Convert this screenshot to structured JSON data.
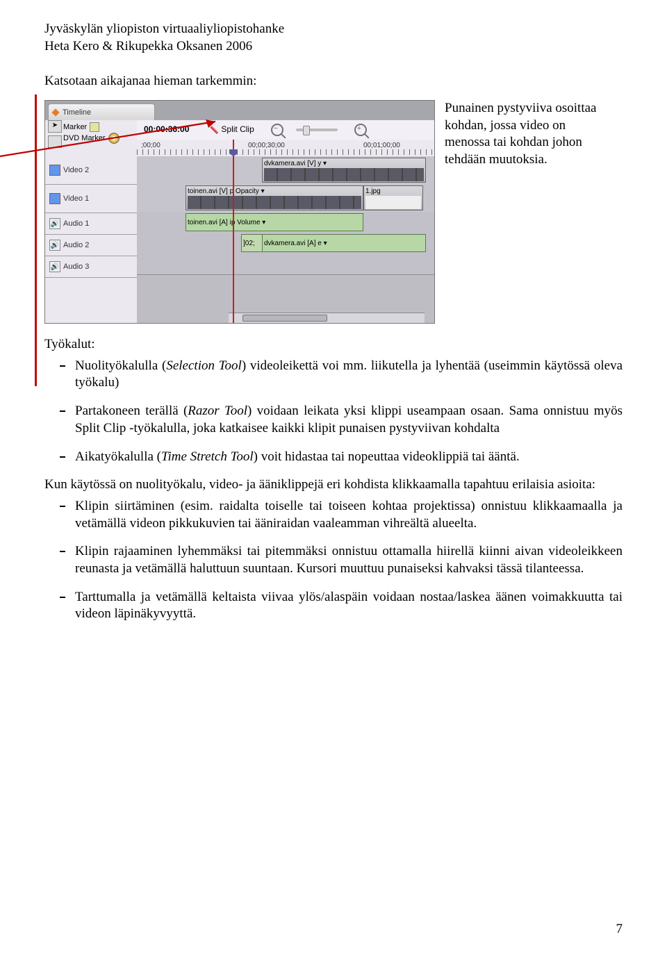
{
  "header": {
    "line1": "Jyväskylän yliopiston virtuaaliyliopistohanke",
    "line2": "Heta Kero & Rikupekka Oksanen 2006"
  },
  "intro": "Katsotaan aikajanaa hieman tarkemmin:",
  "callout": "Punainen pystyviiva osoittaa kohdan, jossa video on menossa tai kohdan johon tehdään muutoksia.",
  "timeline": {
    "tab_label": "Timeline",
    "timecode": "00:00:36:00",
    "split_clip": "Split Clip",
    "left_labels": {
      "marker": "Marker",
      "dvd_marker": "DVD Marker",
      "video2": "Video 2",
      "video1": "Video 1",
      "audio1": "Audio 1",
      "audio2": "Audio 2",
      "audio3": "Audio 3"
    },
    "ruler": {
      "t0": ";00;00",
      "t1": "00;00;30;00",
      "t2": "00;01;00;00"
    },
    "clips": {
      "v2_main": "dvkamera.avi [V] y ▾",
      "v1_main": "toinen.avi [V] p Opacity ▾",
      "v1_img": "1.jpg",
      "a1_main": "toinen.avi [A] ip Volume ▾",
      "a2_left": "]02;",
      "a2_main": "dvkamera.avi [A] e ▾"
    }
  },
  "tools_heading": "Työkalut:",
  "tools_list": [
    {
      "pre": "Nuolityökalulla (",
      "em": "Selection Tool",
      "post": ") videoleikettä voi mm. liikutella ja lyhentää (useimmin käytössä oleva työkalu)"
    },
    {
      "pre": "Partakoneen terällä (",
      "em": "Razor Tool",
      "post": ") voidaan leikata yksi klippi useampaan osaan. Sama onnistuu myös Split Clip -työkalulla, joka katkaisee kaikki klipit punaisen pystyviivan kohdalta"
    },
    {
      "pre": "Aikatyökalulla (",
      "em": "Time Stretch Tool",
      "post": ") voit hidastaa tai nopeuttaa videoklippiä tai ääntä."
    }
  ],
  "para2": "Kun käytössä on nuolityökalu, video- ja ääniklippejä eri kohdista klikkaamalla tapahtuu erilaisia asioita:",
  "actions_list": [
    "Klipin siirtäminen (esim. raidalta toiselle tai toiseen kohtaa projektissa) onnistuu klikkaamaalla ja vetämällä videon pikkukuvien tai ääniraidan vaaleamman vihreältä alueelta.",
    "Klipin rajaaminen lyhemmäksi tai pitemmäksi onnistuu ottamalla hiirellä kiinni aivan videoleikkeen reunasta ja vetämällä haluttuun suuntaan. Kursori muuttuu punaiseksi kahvaksi tässä tilanteessa.",
    "Tarttumalla ja vetämällä keltaista viivaa ylös/alaspäin voidaan nostaa/laskea äänen voimakkuutta tai videon läpinäkyvyyttä."
  ],
  "page_number": "7"
}
